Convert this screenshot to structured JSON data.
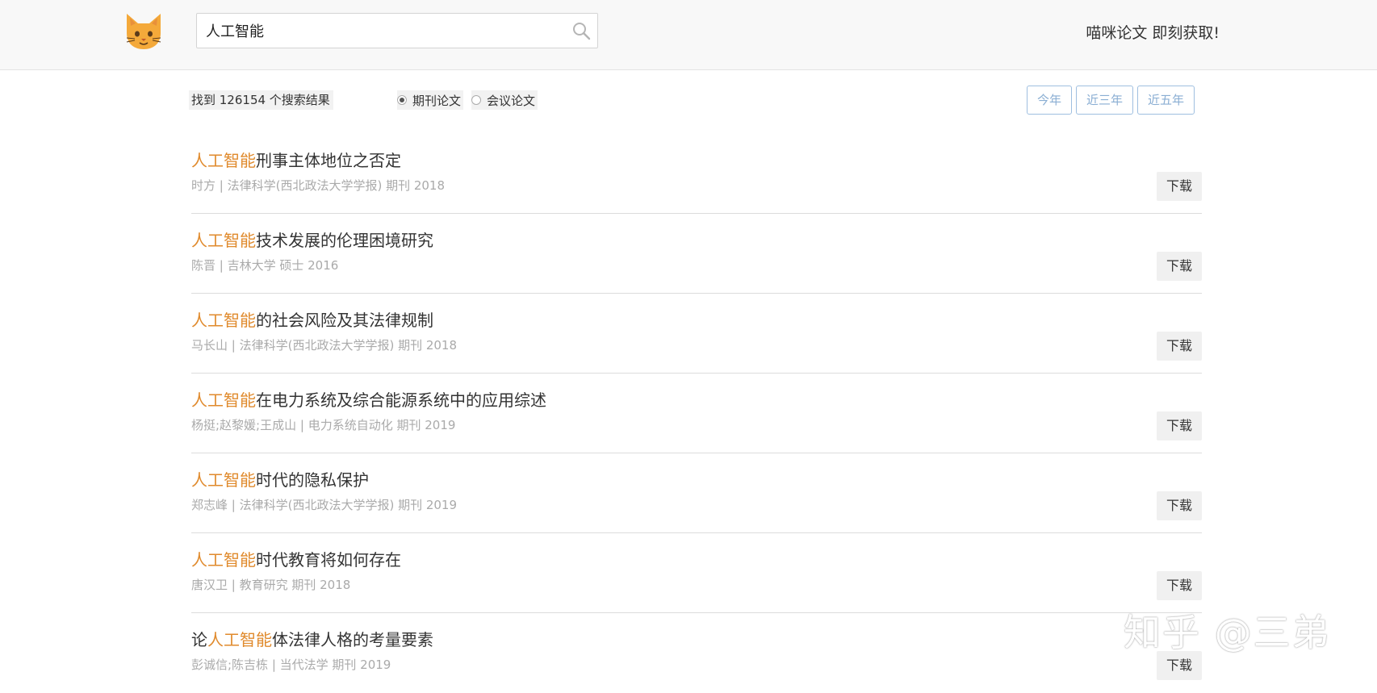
{
  "header": {
    "search_value": "人工智能",
    "slogan": "喵咪论文 即刻获取!"
  },
  "filters": {
    "result_count": "找到 126154 个搜索结果",
    "options": [
      {
        "label": "期刊论文",
        "checked": true
      },
      {
        "label": "会议论文",
        "checked": false
      }
    ],
    "year_buttons": [
      "今年",
      "近三年",
      "近五年"
    ]
  },
  "results": [
    {
      "prefix": "",
      "highlight": "人工智能",
      "suffix": "刑事主体地位之否定",
      "meta": "时方 | 法律科学(西北政法大学学报) 期刊 2018",
      "download": "下载"
    },
    {
      "prefix": "",
      "highlight": "人工智能",
      "suffix": "技术发展的伦理困境研究",
      "meta": "陈晋 | 吉林大学 硕士 2016",
      "download": "下载"
    },
    {
      "prefix": "",
      "highlight": "人工智能",
      "suffix": "的社会风险及其法律规制",
      "meta": "马长山 | 法律科学(西北政法大学学报) 期刊 2018",
      "download": "下载"
    },
    {
      "prefix": "",
      "highlight": "人工智能",
      "suffix": "在电力系统及综合能源系统中的应用综述",
      "meta": "杨挺;赵黎媛;王成山 | 电力系统自动化 期刊 2019",
      "download": "下载"
    },
    {
      "prefix": "",
      "highlight": "人工智能",
      "suffix": "时代的隐私保护",
      "meta": "郑志峰 | 法律科学(西北政法大学学报) 期刊 2019",
      "download": "下载"
    },
    {
      "prefix": "",
      "highlight": "人工智能",
      "suffix": "时代教育将如何存在",
      "meta": "唐汉卫 | 教育研究 期刊 2018",
      "download": "下载"
    },
    {
      "prefix": "论",
      "highlight": "人工智能",
      "suffix": "体法律人格的考量要素",
      "meta": "彭诚信;陈吉栋 | 当代法学 期刊 2019",
      "download": "下载"
    }
  ],
  "watermark": "知乎 @三弟",
  "colors": {
    "highlight": "#e08a2c",
    "meta": "#aaaaaa",
    "year_button": "#8aaed3",
    "logo": "#f4a93a"
  },
  "icons": {
    "logo": "cat-face-icon",
    "search": "search-icon",
    "radio": "radio-icon"
  }
}
